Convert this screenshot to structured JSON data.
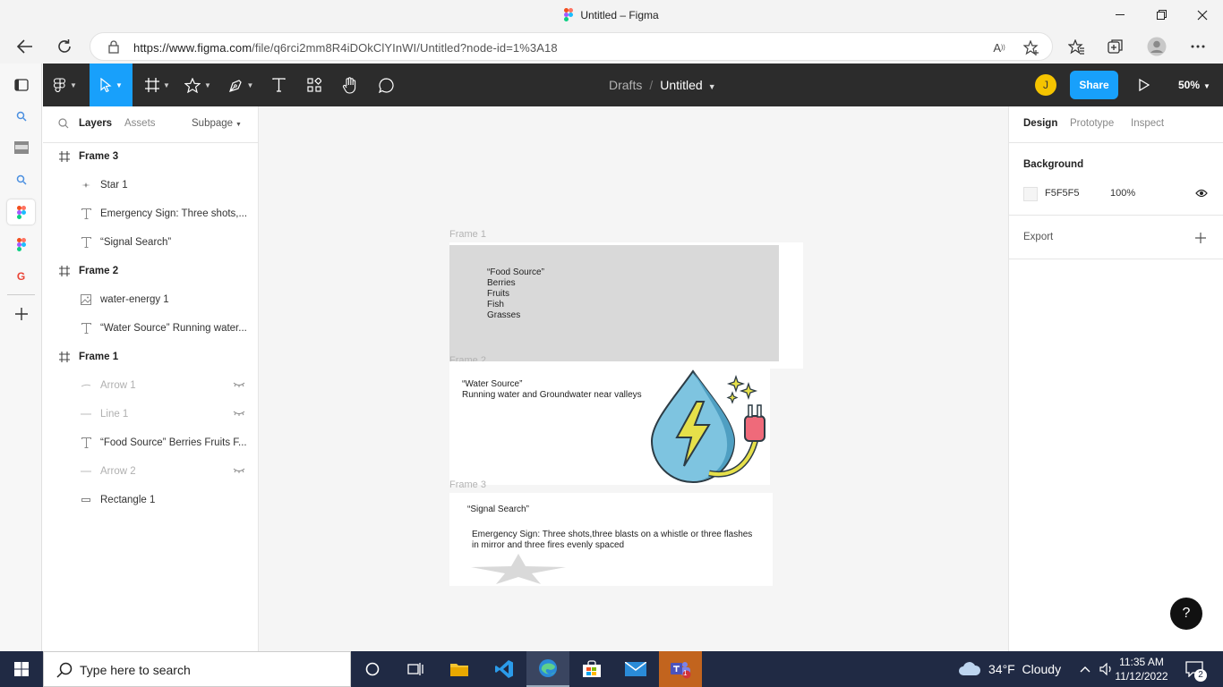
{
  "browser": {
    "window_title": "Untitled – Figma",
    "url_domain": "https://www.figma.com",
    "url_path": "/file/q6rci2mm8R4iDOkClYInWI/Untitled?node-id=1%3A18"
  },
  "figma_toolbar": {
    "breadcrumb_drafts": "Drafts",
    "breadcrumb_sep": "/",
    "file_name": "Untitled",
    "avatar_initial": "J",
    "share_label": "Share",
    "zoom": "50%"
  },
  "left_panel": {
    "tabs": {
      "layers": "Layers",
      "assets": "Assets",
      "page": "Subpage"
    },
    "layers": [
      {
        "name": "Frame 3",
        "type": "frame"
      },
      {
        "name": "Star 1",
        "type": "star"
      },
      {
        "name": "Emergency Sign: Three shots,...",
        "type": "text"
      },
      {
        "name": "“Signal Search”",
        "type": "text"
      },
      {
        "name": "Frame 2",
        "type": "frame"
      },
      {
        "name": "water-energy 1",
        "type": "image"
      },
      {
        "name": "“Water Source” Running water...",
        "type": "text"
      },
      {
        "name": "Frame 1",
        "type": "frame"
      },
      {
        "name": "Arrow 1",
        "type": "arrow",
        "hidden": true
      },
      {
        "name": "Line 1",
        "type": "line",
        "hidden": true
      },
      {
        "name": "“Food Source” Berries Fruits F...",
        "type": "text"
      },
      {
        "name": "Arrow 2",
        "type": "line",
        "hidden": true
      },
      {
        "name": "Rectangle 1",
        "type": "rectangle"
      }
    ]
  },
  "canvas": {
    "frame1": {
      "label": "Frame 1",
      "text": "“Food Source”\nBerries\nFruits\nFish\nGrasses"
    },
    "frame2": {
      "label": "Frame 2",
      "text": "“Water Source”\nRunning water and Groundwater near valleys"
    },
    "frame3": {
      "label": "Frame 3",
      "title": "“Signal Search”",
      "text": "Emergency Sign: Three shots,three blasts on a whistle or three flashes\nin mirror and three fires evenly spaced"
    }
  },
  "right_panel": {
    "tabs": {
      "design": "Design",
      "prototype": "Prototype",
      "inspect": "Inspect"
    },
    "background_heading": "Background",
    "background_hex": "F5F5F5",
    "background_opacity": "100%",
    "export_heading": "Export",
    "help": "?"
  },
  "taskbar": {
    "search_placeholder": "Type here to search",
    "weather": "34°F  Cloudy",
    "time": "11:35 AM",
    "date": "11/12/2022",
    "notifications": "2",
    "teams_badge": "1"
  },
  "colors": {
    "figma_blue": "#18a0fb",
    "toolbar_dark": "#2c2c2c",
    "canvas_bg": "#f5f5f5",
    "taskbar": "#202a44"
  }
}
